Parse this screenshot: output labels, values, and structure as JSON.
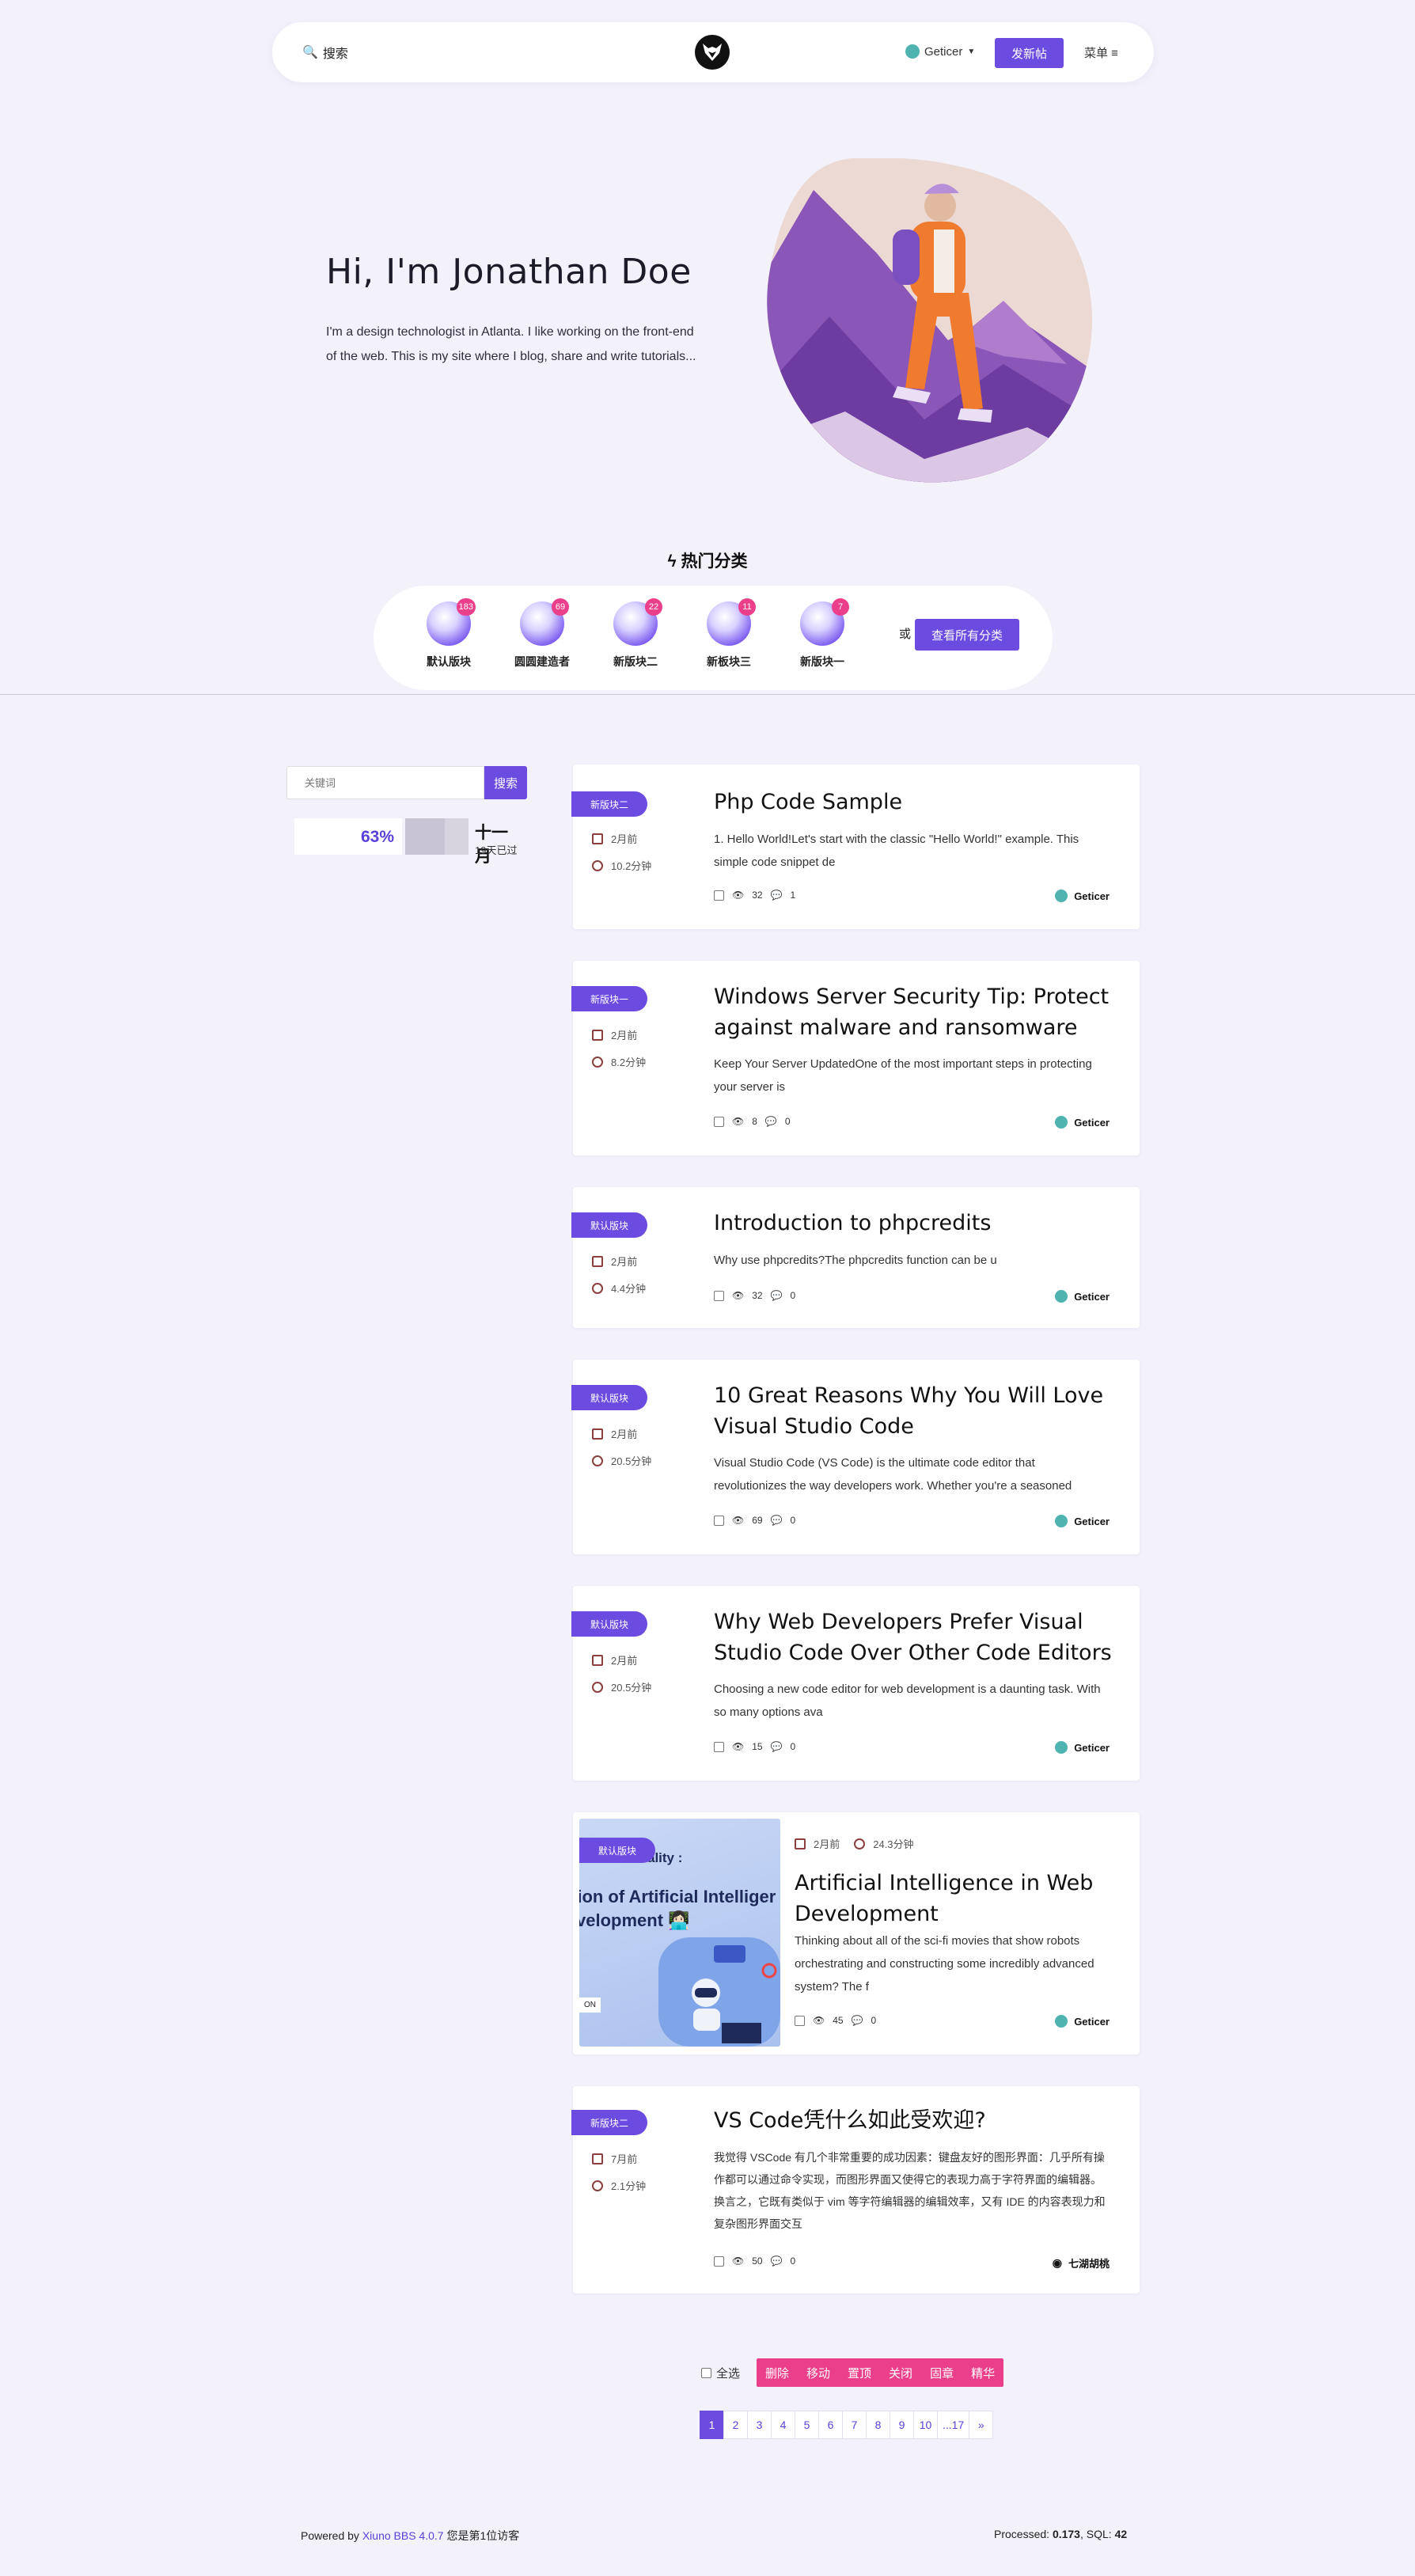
{
  "header": {
    "search_label": "搜索",
    "username": "Geticer",
    "post_button": "发新帖",
    "menu_label": "菜单 ≡"
  },
  "hero": {
    "title": "Hi, I'm Jonathan Doe",
    "text": "I'm a design technologist in Atlanta. I like working on the front-end of the web. This is my site where I blog, share and write tutorials..."
  },
  "hot": {
    "title": "ϟ 热门分类",
    "categories": [
      {
        "name": "默认版块",
        "count": "183"
      },
      {
        "name": "圆圆建造者",
        "count": "69"
      },
      {
        "name": "新版块二",
        "count": "22"
      },
      {
        "name": "新板块三",
        "count": "11"
      },
      {
        "name": "新版块一",
        "count": "7"
      }
    ],
    "or_label": "或",
    "all_button": "查看所有分类"
  },
  "sidebar": {
    "keyword_placeholder": "关键词",
    "search_button": "搜索",
    "progress": {
      "percent": "63%",
      "fraction": 0.63,
      "month": "十一月",
      "days": "19天已过"
    }
  },
  "threads": [
    {
      "tag": "新版块二",
      "date": "2月前",
      "read": "10.2分钟",
      "title": "Php Code Sample",
      "excerpt": "1. Hello World!Let's start with the classic \"Hello World!\" example. This simple code snippet de",
      "views": "32",
      "comments": "1",
      "author": "Geticer"
    },
    {
      "tag": "新版块一",
      "date": "2月前",
      "read": "8.2分钟",
      "title": "Windows Server Security Tip: Protect against malware and ransomware",
      "excerpt": "Keep Your Server UpdatedOne of the most important steps in protecting your server is",
      "views": "8",
      "comments": "0",
      "author": "Geticer"
    },
    {
      "tag": "默认版块",
      "date": "2月前",
      "read": "4.4分钟",
      "title": "Introduction to phpcredits",
      "excerpt": "Why use phpcredits?The phpcredits function can be u",
      "views": "32",
      "comments": "0",
      "author": "Geticer"
    },
    {
      "tag": "默认版块",
      "date": "2月前",
      "read": "20.5分钟",
      "title": "10 Great Reasons Why You Will Love Visual Studio Code",
      "excerpt": "Visual Studio Code (VS Code) is the ultimate code editor that revolutionizes the way developers work. Whether you're a seasoned",
      "views": "69",
      "comments": "0",
      "author": "Geticer"
    },
    {
      "tag": "默认版块",
      "date": "2月前",
      "read": "20.5分钟",
      "title": "Why Web Developers Prefer Visual Studio Code Over Other Code Editors",
      "excerpt": "Choosing a new code editor for web development is a daunting task. With so many options ava",
      "views": "15",
      "comments": "0",
      "author": "Geticer"
    },
    {
      "tag": "默认版块",
      "date": "2月前",
      "read": "24.3分钟",
      "title": "Artificial Intelligence in Web Development",
      "excerpt": " Thinking about all of the sci-fi movies that show robots orchestrating and constructing some incredibly advanced system? The f",
      "views": "45",
      "comments": "0",
      "author": "Geticer",
      "thumb": {
        "line1": "ality :",
        "line2": "tion of Artificial Intelliger",
        "line3": "velopment 👩🏻‍💻",
        "corner": "ON"
      }
    },
    {
      "tag": "新版块二",
      "date": "7月前",
      "read": "2.1分钟",
      "title": "VS Code凭什么如此受欢迎?",
      "excerpt": "我觉得 VSCode 有几个非常重要的成功因素：键盘友好的图形界面：几乎所有操作都可以通过命令实现，而图形界面又使得它的表现力高于字符界面的编辑器。换言之，它既有类似于 vim 等字符编辑器的编辑效率，又有 IDE 的内容表现力和复杂图形界面交互",
      "views": "50",
      "comments": "0",
      "author": "七湖胡桃"
    }
  ],
  "actions": {
    "select_all": "全选",
    "buttons": [
      "删除",
      "移动",
      "置顶",
      "关闭",
      "固章",
      "精华"
    ]
  },
  "pagination": [
    "1",
    "2",
    "3",
    "4",
    "5",
    "6",
    "7",
    "8",
    "9",
    "10",
    "...17",
    "»"
  ],
  "footer": {
    "powered_prefix": "Powered by ",
    "powered_link": "Xiuno BBS 4.0.7",
    "visitor": " 您是第1位访客",
    "processed_label": "Processed: ",
    "processed_value": "0.173",
    "sql_label": ", SQL: ",
    "sql_value": "42"
  },
  "colors": {
    "accent": "#6c4be0",
    "pink": "#ec3f8b",
    "background": "#f3f1fa"
  }
}
